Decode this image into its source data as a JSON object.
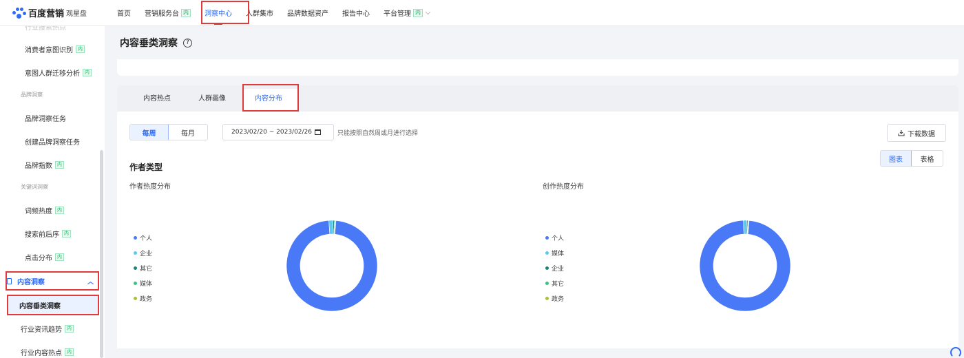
{
  "app": {
    "brand": "百度营销",
    "product": "观星盘"
  },
  "topnav": {
    "items": [
      {
        "label": "首页",
        "tag": ""
      },
      {
        "label": "营销服务台",
        "tag": "内"
      },
      {
        "label": "洞察中心",
        "tag": ""
      },
      {
        "label": "人群集市",
        "tag": ""
      },
      {
        "label": "品牌数据资产",
        "tag": ""
      },
      {
        "label": "报告中心",
        "tag": ""
      },
      {
        "label": "平台管理",
        "tag": "内"
      }
    ]
  },
  "sidebar": {
    "cut_label": "行业搜索热点",
    "items": [
      {
        "label": "消费者意图识别",
        "tag": "内"
      },
      {
        "label": "意图人群迁移分析",
        "tag": "内"
      },
      {
        "label": "品牌洞察任务",
        "tag": ""
      },
      {
        "label": "创建品牌洞察任务",
        "tag": ""
      },
      {
        "label": "品牌指数",
        "tag": "内"
      },
      {
        "label": "词频热度",
        "tag": "内"
      },
      {
        "label": "搜索前后序",
        "tag": "内"
      },
      {
        "label": "点击分布",
        "tag": "内"
      },
      {
        "label": "行业资讯趋势",
        "tag": "内"
      },
      {
        "label": "行业内容热点",
        "tag": "内"
      }
    ],
    "groups": [
      "品牌洞察",
      "关键词洞察"
    ],
    "section": {
      "label": "内容洞察"
    },
    "active": {
      "label": "内容垂类洞察"
    }
  },
  "page": {
    "title": "内容垂类洞察",
    "tabs": [
      "内容热点",
      "人群画像",
      "内容分布"
    ],
    "period_options": [
      "每周",
      "每月"
    ],
    "date_range": "2023/02/20 ~ 2023/02/26",
    "date_hint": "只能按照自然周或月进行选择",
    "download_label": "下载数据",
    "view_options": [
      "图表",
      "表格"
    ],
    "section_title": "作者类型"
  },
  "charts": [
    {
      "subtitle": "作者热度分布",
      "legend": [
        {
          "label": "个人",
          "color": "#4a79f7"
        },
        {
          "label": "企业",
          "color": "#5ac8f0"
        },
        {
          "label": "其它",
          "color": "#24807a"
        },
        {
          "label": "媒体",
          "color": "#3bc281"
        },
        {
          "label": "政务",
          "color": "#a6c334"
        }
      ],
      "chart_data": {
        "type": "pie",
        "categories": [
          "个人",
          "企业",
          "其它",
          "媒体",
          "政务"
        ],
        "values": [
          97.5,
          1.5,
          0.5,
          0.3,
          0.2
        ]
      }
    },
    {
      "subtitle": "创作热度分布",
      "legend": [
        {
          "label": "个人",
          "color": "#4a79f7"
        },
        {
          "label": "媒体",
          "color": "#5ac8f0"
        },
        {
          "label": "企业",
          "color": "#24807a"
        },
        {
          "label": "其它",
          "color": "#3bc281"
        },
        {
          "label": "政务",
          "color": "#a6c334"
        }
      ],
      "chart_data": {
        "type": "pie",
        "categories": [
          "个人",
          "媒体",
          "企业",
          "其它",
          "政务"
        ],
        "values": [
          98.0,
          1.2,
          0.4,
          0.25,
          0.15
        ]
      }
    }
  ]
}
